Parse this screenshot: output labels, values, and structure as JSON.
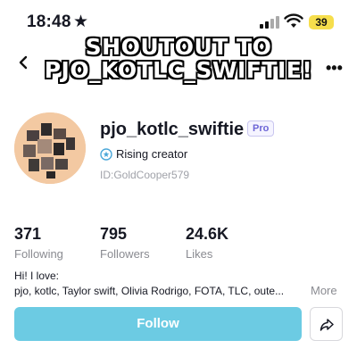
{
  "status_bar": {
    "time": "18:48",
    "battery": "39"
  },
  "caption": {
    "line1": "SHOUTOUT TO",
    "line2": "PJO_KOTLC_SWIFTIE!"
  },
  "profile": {
    "username": "pjo_kotlc_swiftie",
    "badge": "Pro",
    "status": "Rising creator",
    "user_id": "ID:GoldCooper579"
  },
  "stats": [
    {
      "value": "371",
      "label": "Following"
    },
    {
      "value": "795",
      "label": "Followers"
    },
    {
      "value": "24.6K",
      "label": "Likes"
    }
  ],
  "bio": {
    "line1": "Hi! I love:",
    "line2": "pjo, kotlc, Taylor swift, Olivia Rodrigo, FOTA, TLC, oute...",
    "more": "More"
  },
  "actions": {
    "follow": "Follow"
  },
  "colors": {
    "follow_button": "#6ccbe3",
    "pro_badge": "#6d65d6",
    "battery": "#f6de4c"
  },
  "icons": [
    "star-icon",
    "signal-icon",
    "wifi-icon",
    "back-icon",
    "more-icon",
    "rising-creator-icon",
    "share-icon"
  ]
}
